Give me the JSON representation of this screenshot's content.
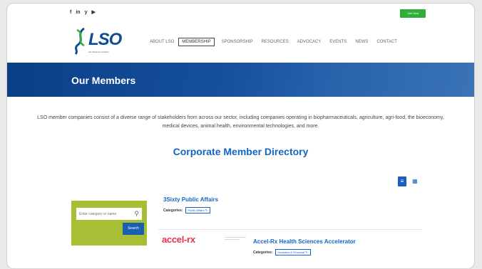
{
  "topbar": {
    "social": [
      {
        "label": "f",
        "icon": "facebook-icon"
      },
      {
        "label": "in",
        "icon": "linkedin-icon"
      },
      {
        "label": "y",
        "icon": "twitter-icon"
      },
      {
        "label": "▶",
        "icon": "youtube-icon"
      }
    ],
    "join_label": "Join Now"
  },
  "logo": {
    "text": "LSO",
    "tagline": "Life Sciences Ontario"
  },
  "nav": [
    {
      "label": "ABOUT LSO",
      "active": false
    },
    {
      "label": "MEMBERSHIP",
      "active": true
    },
    {
      "label": "SPONSORSHIP",
      "active": false
    },
    {
      "label": "RESOURCES",
      "active": false
    },
    {
      "label": "ADVOCACY",
      "active": false
    },
    {
      "label": "EVENTS",
      "active": false
    },
    {
      "label": "NEWS",
      "active": false
    },
    {
      "label": "CONTACT",
      "active": false
    }
  ],
  "banner": {
    "title": "Our Members"
  },
  "intro": "LSO member companies consist of a diverse range of stakeholders from across our sector, including companies operating in biopharmaceuticals, agriculture, agri-food, the bioeconomy, medical devices, animal health, environmental technologies, and more.",
  "directory": {
    "title": "Corporate Member Directory"
  },
  "view_toggle": {
    "list_icon": "≡",
    "grid_icon": "▦"
  },
  "search": {
    "placeholder": "Enter category or name",
    "icon": "⚲",
    "button_label": "Search"
  },
  "members": [
    {
      "name": "3Sixty Public Affairs",
      "categories_label": "Categories:",
      "category": "Public Affairs ✎"
    },
    {
      "name": "Accel-Rx Health Sciences Accelerator",
      "logo_text": "accel-rx",
      "categories_label": "Categories:",
      "category": "Incubator & Financial ✎"
    }
  ],
  "colors": {
    "primary": "#1266c4",
    "banner": "#0b3f86",
    "green": "#a6bf35",
    "join": "#2fae3a",
    "accel": "#e8304a"
  }
}
